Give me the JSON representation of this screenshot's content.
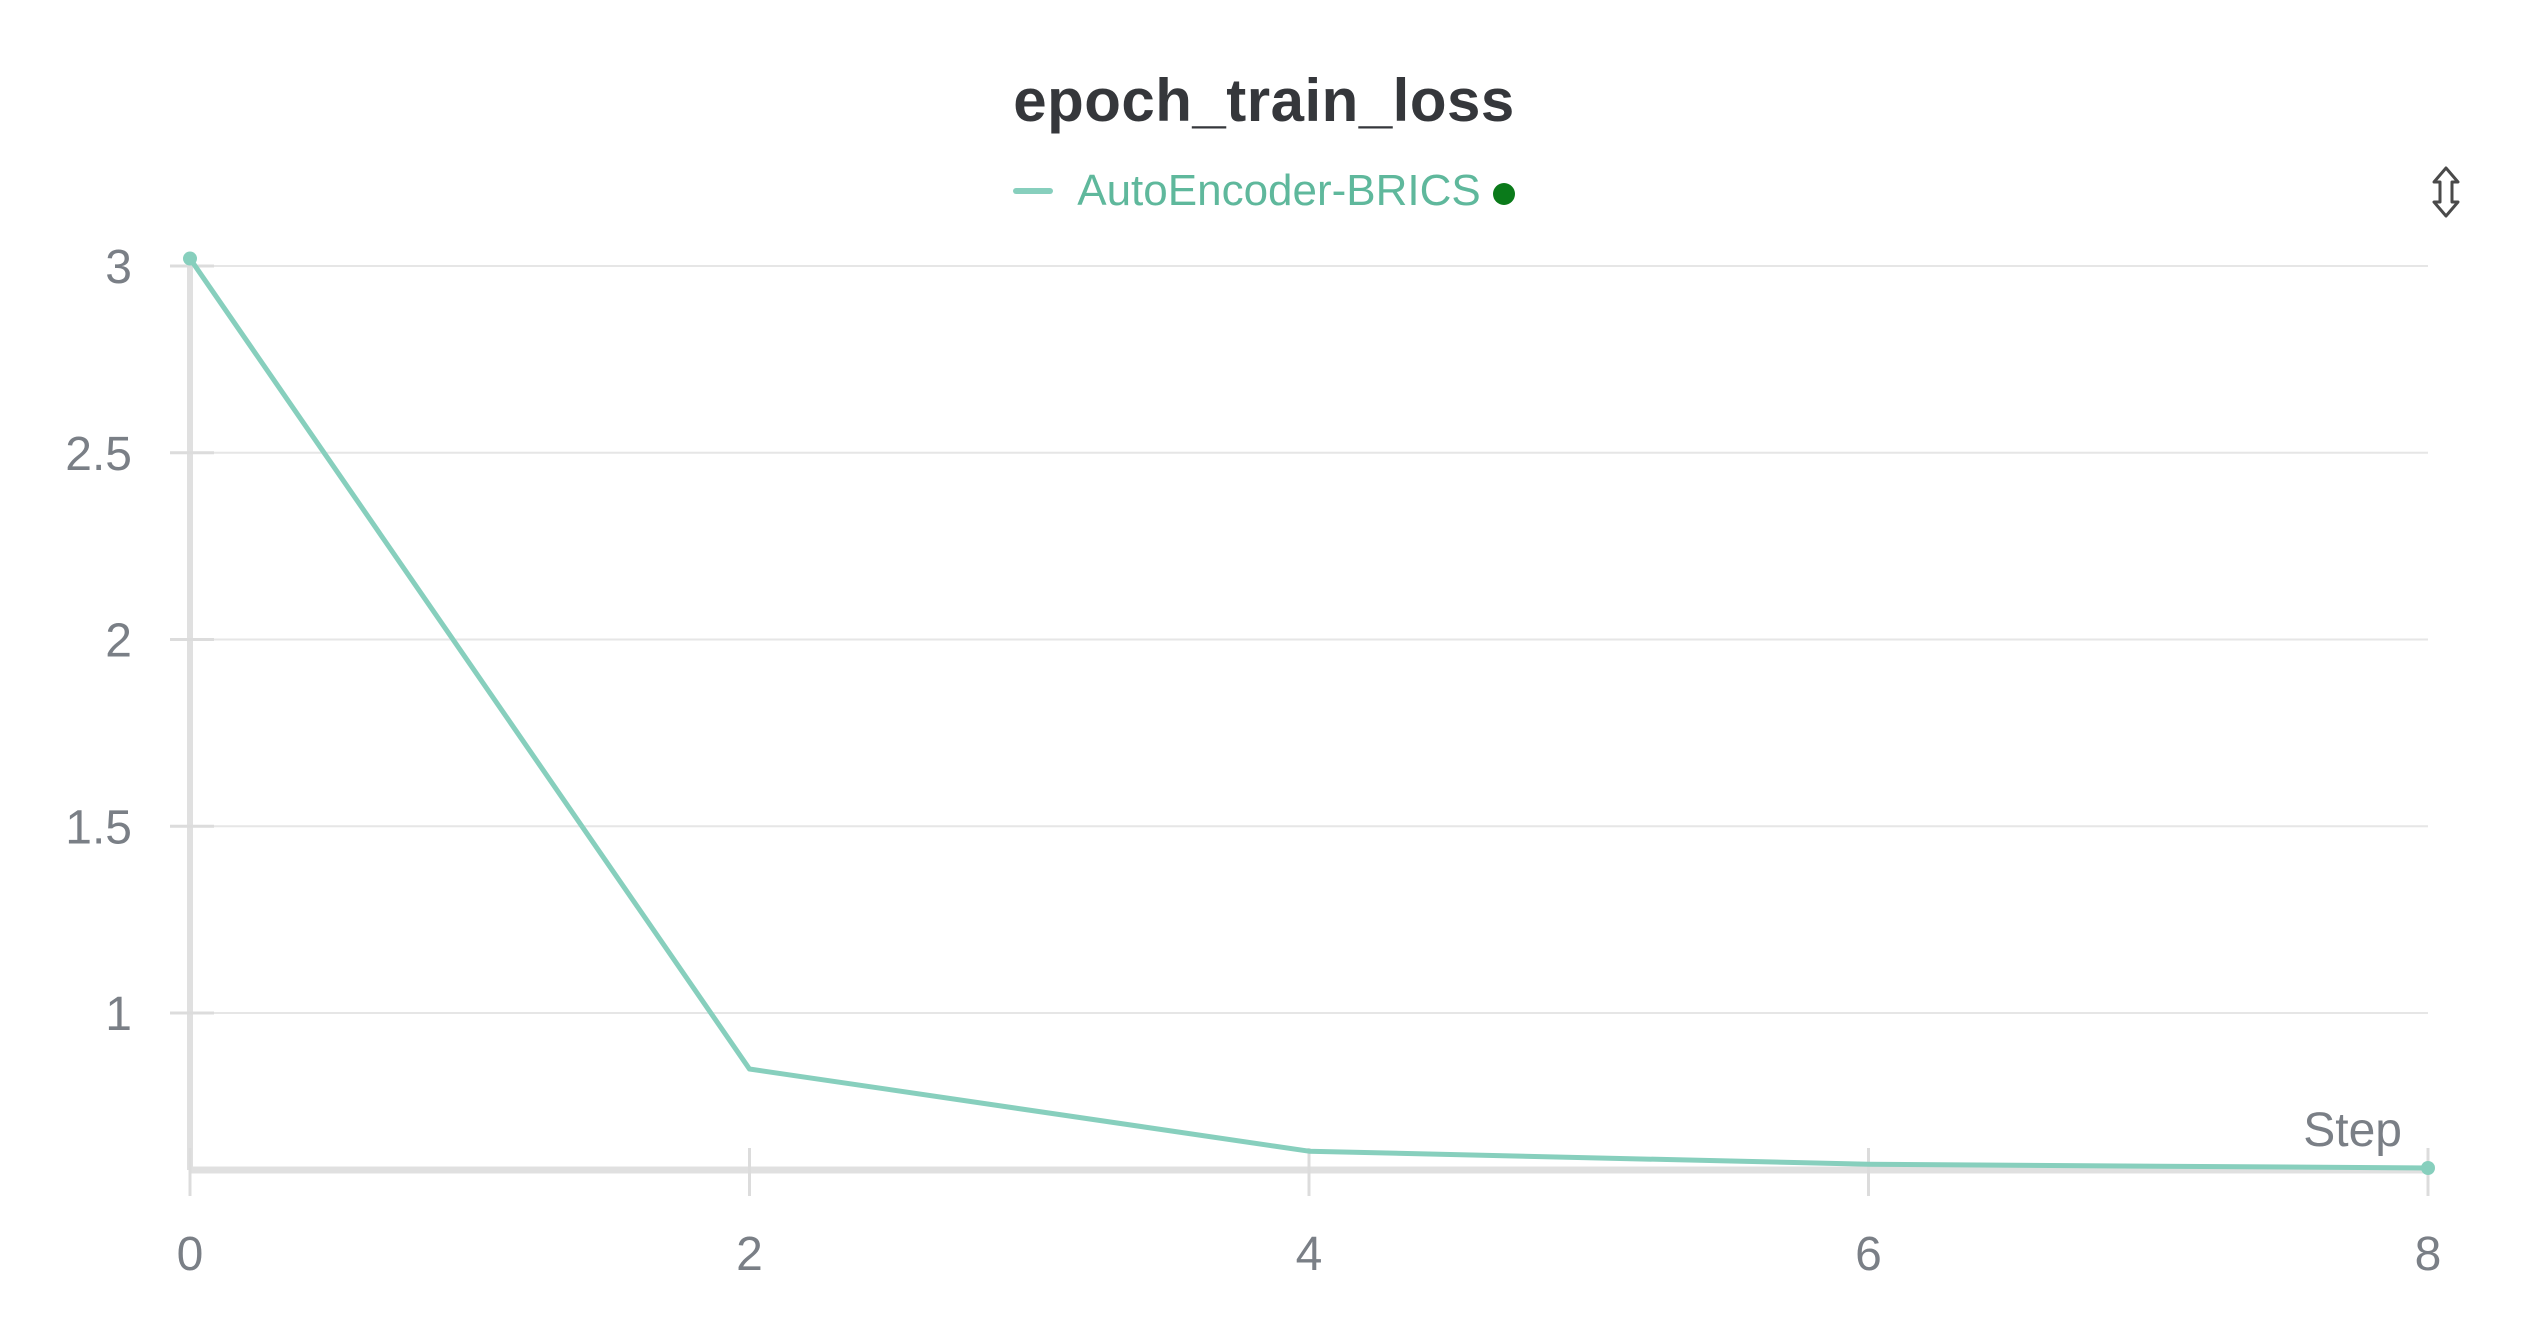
{
  "chart_data": {
    "type": "line",
    "title": "epoch_train_loss",
    "xlabel": "Step",
    "ylabel": "",
    "x": [
      0,
      2,
      4,
      6,
      8
    ],
    "series": [
      {
        "name": "AutoEncoder-BRICS",
        "color": "#87cfbd",
        "values": [
          3.02,
          0.85,
          0.63,
          0.595,
          0.585
        ]
      }
    ],
    "xlim": [
      0,
      8
    ],
    "ylim": [
      0.58,
      3.0
    ],
    "x_ticks": [
      "0",
      "2",
      "4",
      "6",
      "8"
    ],
    "y_ticks": [
      "3",
      "2.5",
      "2",
      "1.5",
      "1"
    ],
    "y_tick_values": [
      3,
      2.5,
      2,
      1.5,
      1
    ],
    "x_tick_values": [
      0,
      2,
      4,
      6,
      8
    ],
    "grid": "horizontal",
    "legend": "top-center",
    "legend_status_color": "#0a7a1a"
  },
  "toolbar": {
    "resize_icon": "resize-vertical-icon"
  }
}
